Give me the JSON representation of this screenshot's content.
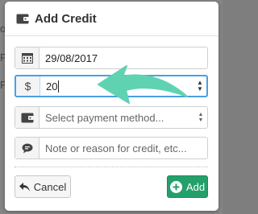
{
  "background_fragments": [
    "o",
    "P",
    "P"
  ],
  "modal": {
    "title": "Add Credit",
    "title_icon": "wallet-icon"
  },
  "form": {
    "date": {
      "icon": "calendar-icon",
      "value": "29/08/2017"
    },
    "amount": {
      "addon": "$",
      "value": "20"
    },
    "payment_method": {
      "icon": "wallet-icon",
      "placeholder": "Select payment method..."
    },
    "note": {
      "icon": "comment-icon",
      "placeholder": "Note or reason for credit, etc..."
    }
  },
  "buttons": {
    "cancel_label": "Cancel",
    "add_label": "Add"
  },
  "colors": {
    "accent_focus": "#4b9fe0",
    "add_button": "#24a06b",
    "annotation_arrow": "#5fd3b1"
  }
}
